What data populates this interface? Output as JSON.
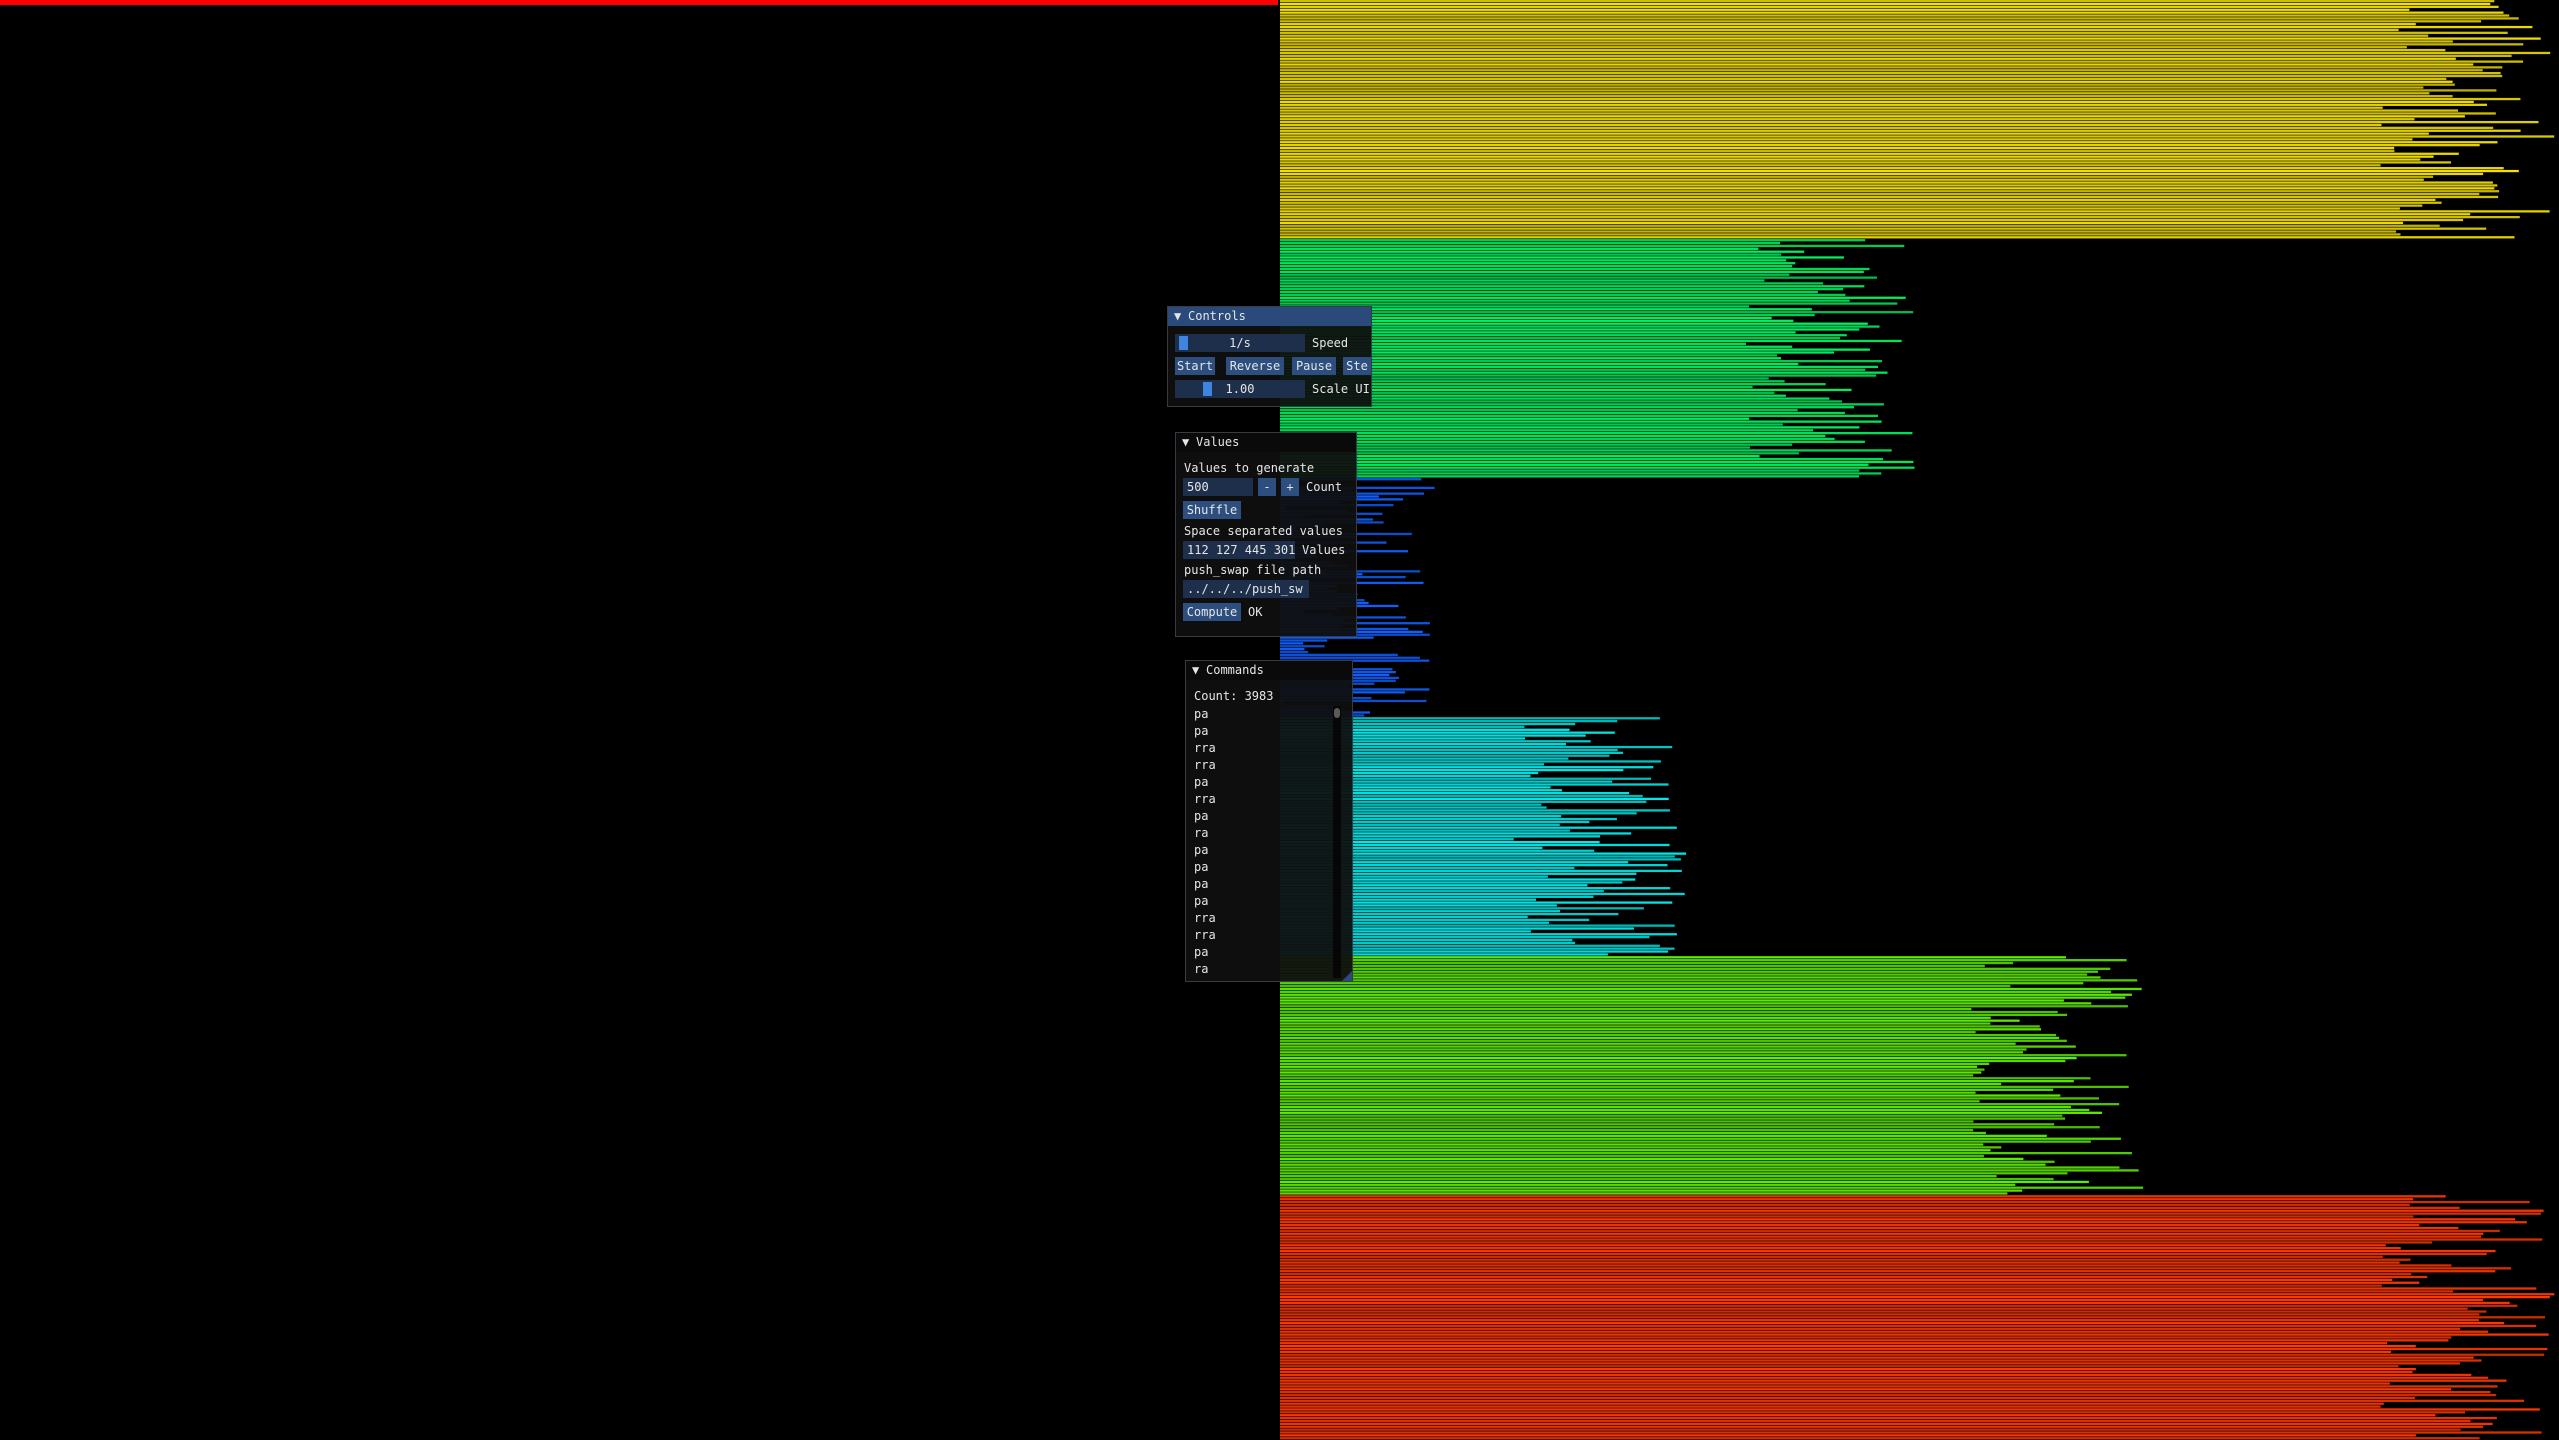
{
  "viz": {
    "stack_a": {
      "bar_count": 500,
      "segments": [
        {
          "color": "#f3e000",
          "ranks": [
            430,
            499
          ]
        },
        {
          "color": "#00f060",
          "ranks": [
            180,
            249
          ]
        },
        {
          "color": "#1060ff",
          "ranks": [
            0,
            60
          ]
        },
        {
          "color": "#00e8e8",
          "ranks": [
            90,
            159
          ]
        },
        {
          "color": "#60f000",
          "ranks": [
            270,
            339
          ]
        },
        {
          "color": "#ff3800",
          "ranks": [
            430,
            499
          ]
        }
      ]
    },
    "stack_b": {
      "highlight_color": "#ff0000"
    }
  },
  "controls": {
    "title": "Controls",
    "speed_value": "1/s",
    "speed_label": "Speed",
    "speed_fraction": 0.02,
    "buttons": {
      "start": "Start",
      "reverse": "Reverse",
      "pause": "Pause",
      "step": "Ste"
    },
    "scale_value": "1.00",
    "scale_label": "Scale UI",
    "scale_fraction": 0.22
  },
  "values": {
    "title": "Values",
    "generate_heading": "Values to generate",
    "count_value": "500",
    "minus": "-",
    "plus": "+",
    "count_label": "Count",
    "shuffle": "Shuffle",
    "separated_heading": "Space separated values",
    "values_text": "112 127 445 301",
    "values_label": "Values",
    "path_heading": "push_swap file path",
    "path_value": "../../../push_sw",
    "compute": "Compute",
    "status": "OK"
  },
  "commands": {
    "title": "Commands",
    "count_text": "Count: 3983",
    "items": [
      "pa",
      "pa",
      "rra",
      "rra",
      "pa",
      "rra",
      "pa",
      "ra",
      "pa",
      "pa",
      "pa",
      "pa",
      "rra",
      "rra",
      "pa",
      "ra"
    ]
  }
}
